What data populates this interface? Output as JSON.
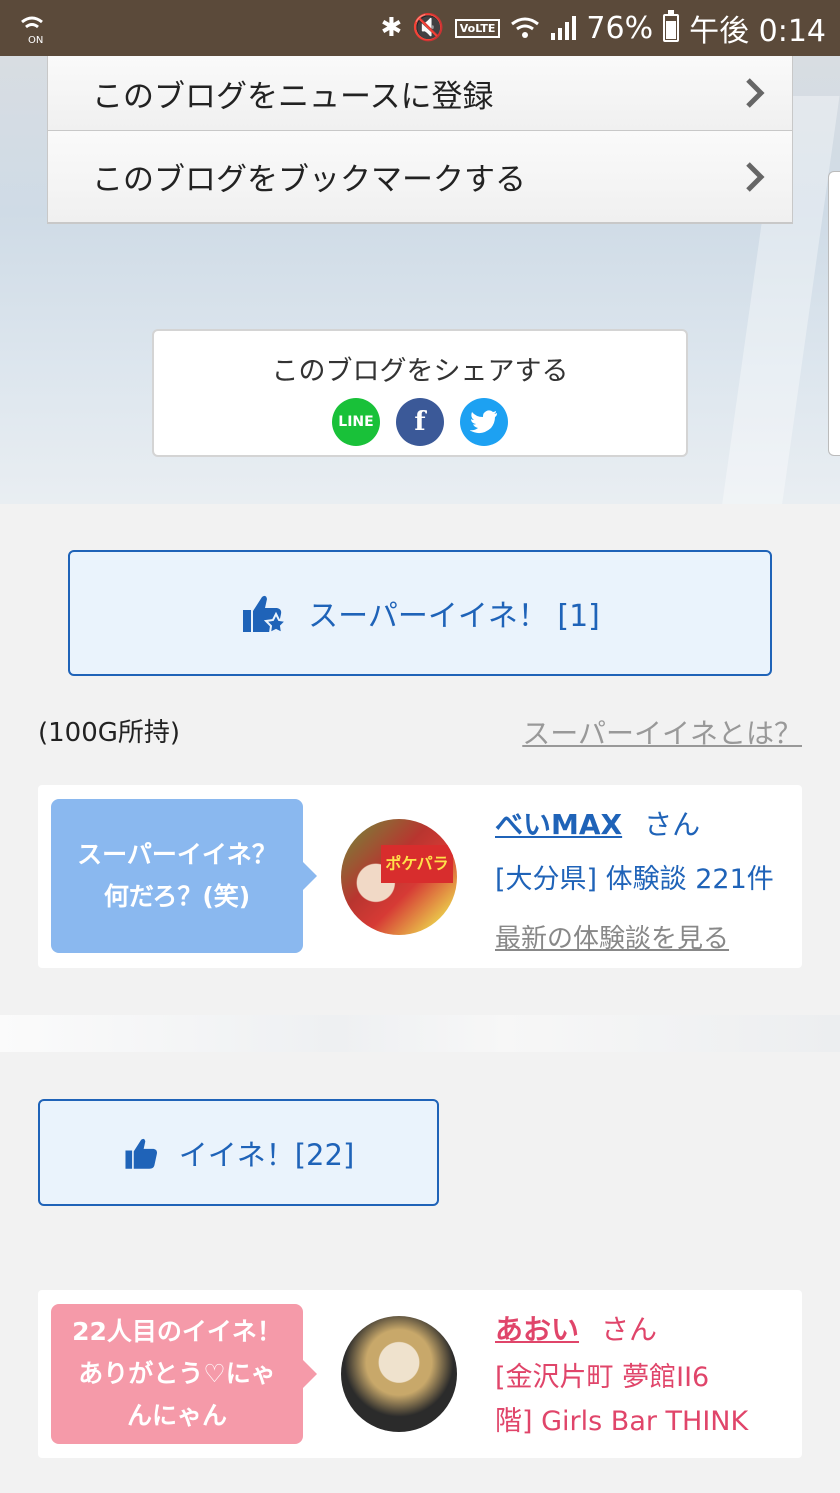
{
  "status_bar": {
    "battery": "76%",
    "time": "午後 0:14",
    "icons": [
      "wifi-calling-icon",
      "bluetooth-icon",
      "mute-icon",
      "volte-icon",
      "wifi-icon",
      "signal-icon",
      "battery-icon"
    ],
    "volte_label": "VoLTE"
  },
  "menu": {
    "items": [
      {
        "label": "このブログをニュースに登録"
      },
      {
        "label": "このブログをブックマークする"
      }
    ]
  },
  "share": {
    "title": "このブログをシェアする",
    "line_label": "LINE",
    "fb_label": "f"
  },
  "super_like": {
    "label": "スーパーイイネ！ [1]",
    "owned": "(100G所持)",
    "what_is": "スーパーイイネとは？"
  },
  "super_card": {
    "bubble": [
      "スーパーイイネ？",
      "何だろ？(笑)"
    ],
    "user": "べいMAX",
    "honorific": "さん",
    "prefecture": "[大分県] 体験談 221件",
    "link": "最新の体験談を見る",
    "avatar_sign": "ポケパラ"
  },
  "like": {
    "label": "イイネ！[22]"
  },
  "like_card": {
    "bubble": [
      "22人目のイイネ！",
      "ありがとう♡にゃ",
      "んにゃん"
    ],
    "user": "あおい",
    "honorific": "さん",
    "place_line1": "[金沢片町 夢館II6",
    "place_line2": "階] Girls Bar THINK"
  },
  "colors": {
    "accent": "#1f63b8",
    "pink": "#e0456a",
    "status_bar": "#5b4a3a"
  }
}
